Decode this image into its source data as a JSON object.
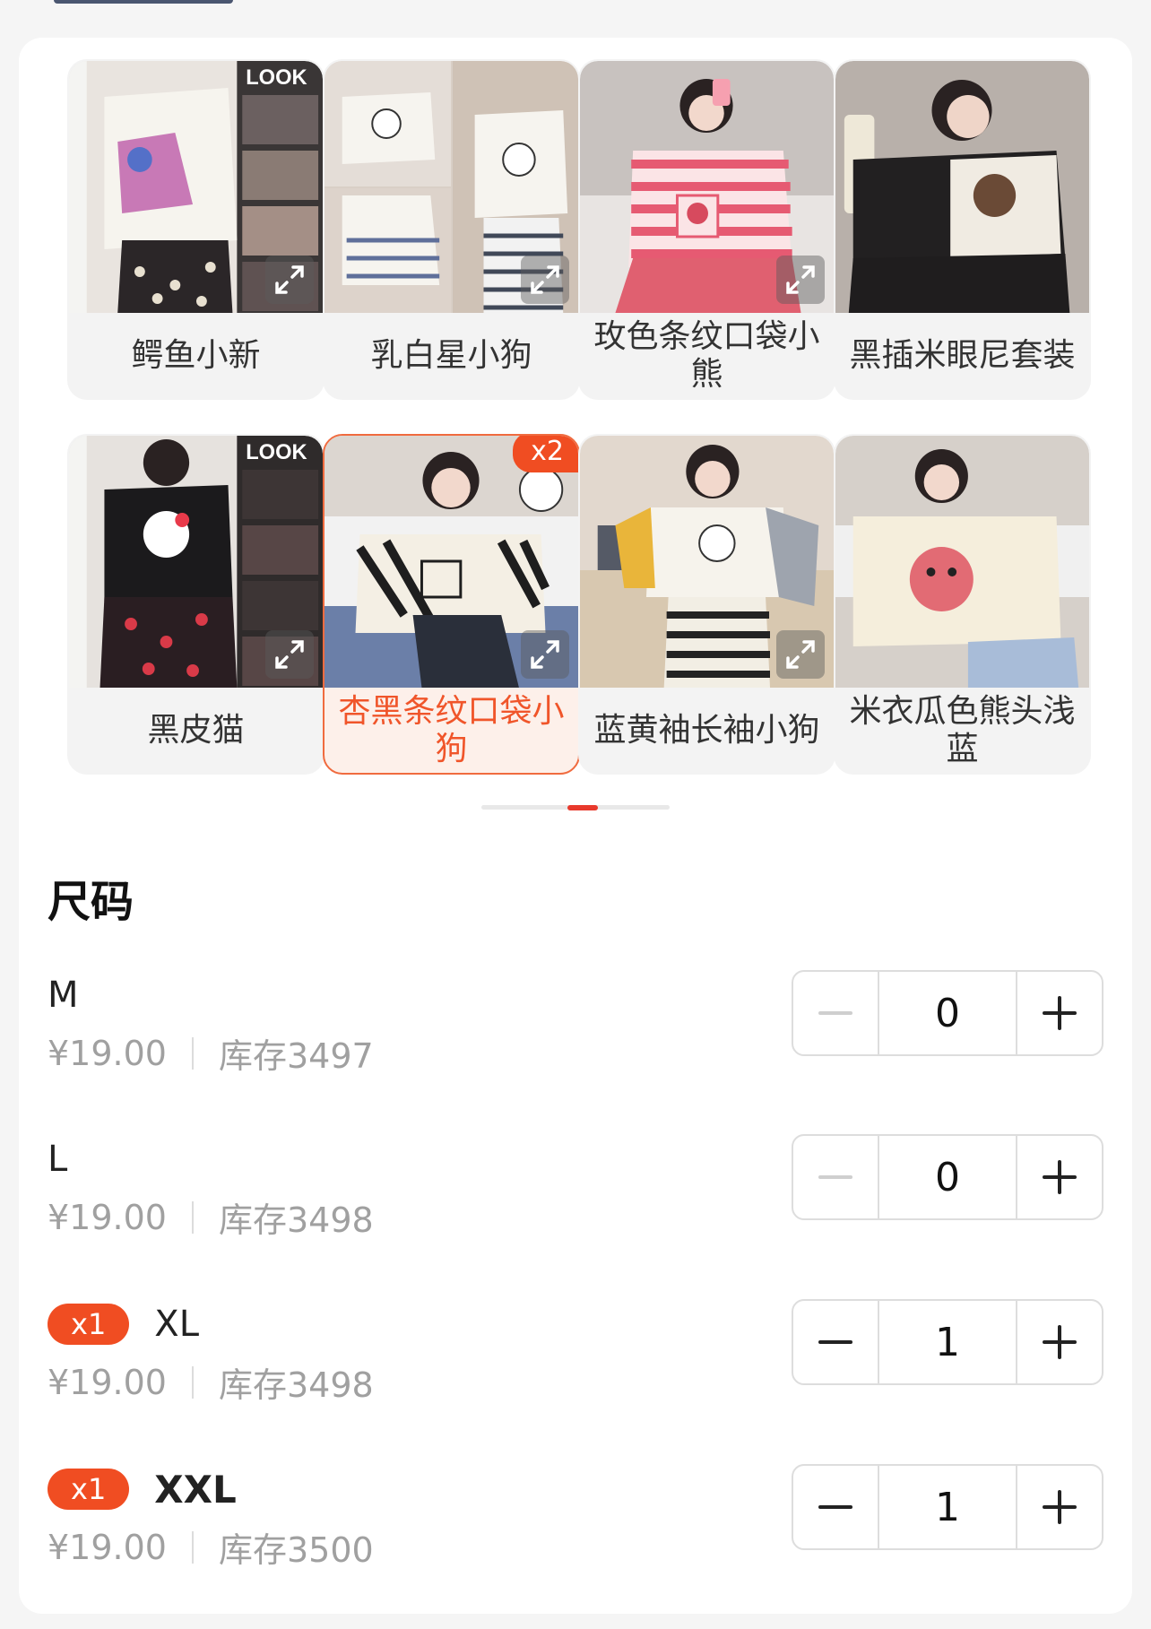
{
  "variants": [
    {
      "label": "鳄鱼小新",
      "theme": "crayon",
      "selected": false
    },
    {
      "label": "乳白星小狗",
      "theme": "cream-dog",
      "selected": false
    },
    {
      "label": "玫色条纹口袋小熊",
      "theme": "rose-bear",
      "selected": false
    },
    {
      "label": "黑插米眼尼套装",
      "theme": "black-cream",
      "selected": false
    },
    {
      "label": "黑皮猫",
      "theme": "black-cat",
      "selected": false
    },
    {
      "label": "杏黑条纹口袋小狗",
      "theme": "apricot-stripe",
      "selected": true,
      "badge": "x2"
    },
    {
      "label": "蓝黄袖长袖小狗",
      "theme": "blue-yellow",
      "selected": false
    },
    {
      "label": "米衣瓜色熊头浅蓝",
      "theme": "cream-bear",
      "selected": false
    }
  ],
  "size_section": {
    "title": "尺码",
    "rows": [
      {
        "name": "M",
        "price": "¥19.00",
        "stock": "库存3497",
        "qty": "0",
        "badge": "",
        "bold": false
      },
      {
        "name": "L",
        "price": "¥19.00",
        "stock": "库存3498",
        "qty": "0",
        "badge": "",
        "bold": false
      },
      {
        "name": "XL",
        "price": "¥19.00",
        "stock": "库存3498",
        "qty": "1",
        "badge": "x1",
        "bold": false
      },
      {
        "name": "XXL",
        "price": "¥19.00",
        "stock": "库存3500",
        "qty": "1",
        "badge": "x1",
        "bold": true
      }
    ]
  },
  "colors": {
    "accent": "#f04d22",
    "selected_label": "#f0552a",
    "indicator_active": "#e8392c"
  },
  "icons": {
    "expand": "expand-icon",
    "minus": "minus-icon",
    "plus": "plus-icon"
  }
}
